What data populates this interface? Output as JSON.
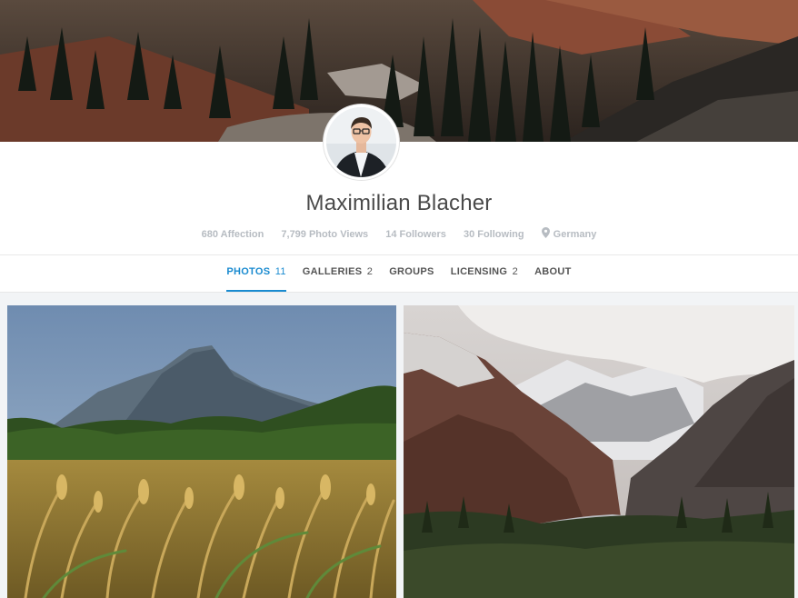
{
  "profile": {
    "name": "Maximilian Blacher",
    "stats": {
      "affection": "680 Affection",
      "photo_views": "7,799 Photo Views",
      "followers": "14 Followers",
      "following": "30 Following",
      "location": "Germany"
    }
  },
  "tabs": [
    {
      "label": "PHOTOS",
      "count": "11",
      "active": true
    },
    {
      "label": "GALLERIES",
      "count": "2",
      "active": false
    },
    {
      "label": "GROUPS",
      "count": "",
      "active": false
    },
    {
      "label": "LICENSING",
      "count": "2",
      "active": false
    },
    {
      "label": "ABOUT",
      "count": "",
      "active": false
    }
  ],
  "colors": {
    "accent": "#1a8bd0",
    "stats_text": "#b7bcc2",
    "name_text": "#4a4a4a"
  },
  "icons": {
    "location": "map-pin-icon"
  }
}
